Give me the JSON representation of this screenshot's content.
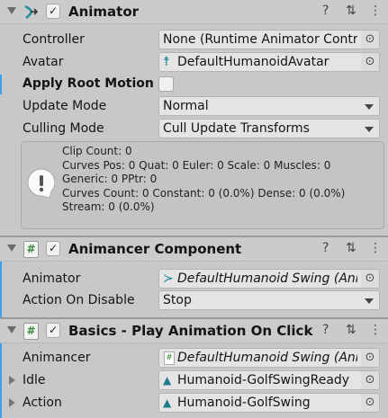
{
  "animator": {
    "title": "Animator",
    "enabled": true,
    "controller_label": "Controller",
    "controller_value": "None (Runtime Animator Controller)",
    "avatar_label": "Avatar",
    "avatar_value": "DefaultHumanoidAvatar",
    "apply_root_motion_label": "Apply Root Motion",
    "apply_root_motion": false,
    "update_mode_label": "Update Mode",
    "update_mode_value": "Normal",
    "culling_mode_label": "Culling Mode",
    "culling_mode_value": "Cull Update Transforms",
    "info_lines": [
      "Clip Count: 0",
      "Curves Pos: 0 Quat: 0 Euler: 0 Scale: 0 Muscles: 0",
      "Generic: 0 PPtr: 0",
      "Curves Count: 0 Constant: 0 (0.0%) Dense: 0 (0.0%)",
      "Stream: 0 (0.0%)"
    ]
  },
  "animancer": {
    "title": "Animancer Component",
    "enabled": true,
    "animator_label": "Animator",
    "animator_value": "DefaultHumanoid Swing (Animator)",
    "action_on_disable_label": "Action On Disable",
    "action_on_disable_value": "Stop"
  },
  "basics": {
    "title": "Basics - Play Animation On Click",
    "enabled": true,
    "animancer_label": "Animancer",
    "animancer_value": "DefaultHumanoid Swing (Animancer Component)",
    "idle_label": "Idle",
    "idle_value": "Humanoid-GolfSwingReady",
    "action_label": "Action",
    "action_value": "Humanoid-GolfSwing"
  },
  "header_icons": {
    "help": "?",
    "settings": "⇅",
    "menu": "⋮",
    "check": "✓",
    "pick": "⊙"
  },
  "colors": {
    "accent": "#3a9ff0",
    "icon_teal": "#1c8c9c",
    "script_green": "#3c8a3c"
  }
}
